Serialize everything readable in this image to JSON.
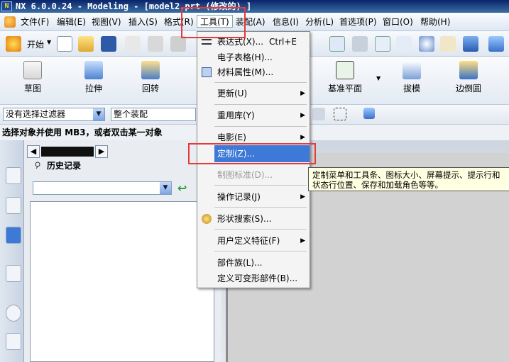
{
  "window": {
    "title": "NX 6.0.0.24 - Modeling - [model2.prt (修改的)  ]"
  },
  "menubar": {
    "items": [
      "文件(F)",
      "编辑(E)",
      "视图(V)",
      "插入(S)",
      "格式(R)",
      "工具(T)",
      "装配(A)",
      "信息(I)",
      "分析(L)",
      "首选项(P)",
      "窗口(O)",
      "帮助(H)"
    ],
    "selected": "工具(T)"
  },
  "toolbar": {
    "start_label": "开始"
  },
  "feature_toolbar": {
    "buttons": [
      "草图",
      "拉伸",
      "回转",
      "基准平面",
      "拔模",
      "边倒圆"
    ]
  },
  "filterbar": {
    "selection_filter": "没有选择过滤器",
    "scope": "整个装配"
  },
  "status": {
    "message": "选择对象并使用 MB3，或者双击某一对象"
  },
  "navigator": {
    "title": "历史记录"
  },
  "tools_menu": {
    "items": [
      {
        "label": "表达式(X)...",
        "shortcut": "Ctrl+E",
        "icon": "expression-icon"
      },
      {
        "label": "电子表格(H)..."
      },
      {
        "label": "材料属性(M)...",
        "icon": "material-icon"
      },
      {
        "label": "更新(U)",
        "submenu": true
      },
      {
        "label": "重用库(Y)",
        "submenu": true
      },
      {
        "label": "电影(E)",
        "submenu": true
      },
      {
        "label": "定制(Z)...",
        "highlighted": true
      },
      {
        "label": "制图标准(D)...",
        "disabled": true
      },
      {
        "label": "操作记录(J)",
        "submenu": true
      },
      {
        "label": "形状搜索(S)...",
        "icon": "shape-search-icon"
      },
      {
        "label": "用户定义特征(F)",
        "submenu": true
      },
      {
        "label": "部件族(L)..."
      },
      {
        "label": "定义可变形部件(B)..."
      }
    ]
  },
  "tooltip": {
    "text": "定制菜单和工具条、图标大小、屏幕提示、提示行和状态行位置、保存和加载角色等等。"
  },
  "colors": {
    "highlight": "#3d7ad8",
    "annotation": "#e43a3a",
    "tooltip_bg": "#ffffe1"
  }
}
